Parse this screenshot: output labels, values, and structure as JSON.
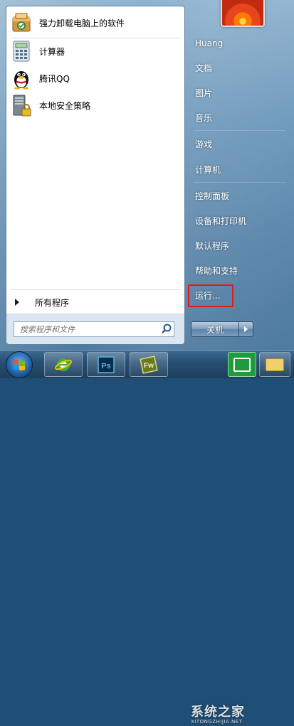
{
  "left_panel": {
    "programs": [
      {
        "label": "强力卸载电脑上的软件",
        "icon": "uninstaller-icon"
      },
      {
        "label": "计算器",
        "icon": "calculator-icon"
      },
      {
        "label": "腾讯QQ",
        "icon": "qq-penguin-icon"
      },
      {
        "label": "本地安全策略",
        "icon": "security-policy-icon"
      }
    ],
    "all_programs": "所有程序",
    "search_placeholder": "搜索程序和文件"
  },
  "right_panel": {
    "items": [
      {
        "label": "Huang"
      },
      {
        "label": "文档"
      },
      {
        "label": "图片"
      },
      {
        "label": "音乐"
      },
      {
        "label": "游戏"
      },
      {
        "label": "计算机"
      },
      {
        "label": "控制面板"
      },
      {
        "label": "设备和打印机"
      },
      {
        "label": "默认程序"
      },
      {
        "label": "帮助和支持"
      },
      {
        "label": "运行..."
      }
    ],
    "shutdown_label": "关机",
    "highlight_color": "#e11a1a"
  },
  "taskbar": {
    "items": [
      {
        "name": "start-orb"
      },
      {
        "name": "ie-icon"
      },
      {
        "name": "photoshop-icon",
        "text": "Ps"
      },
      {
        "name": "fireworks-icon",
        "text": "Fw"
      }
    ],
    "watermark": "系统之家",
    "watermark_sub": "XITONGZHIJIA.NET"
  }
}
